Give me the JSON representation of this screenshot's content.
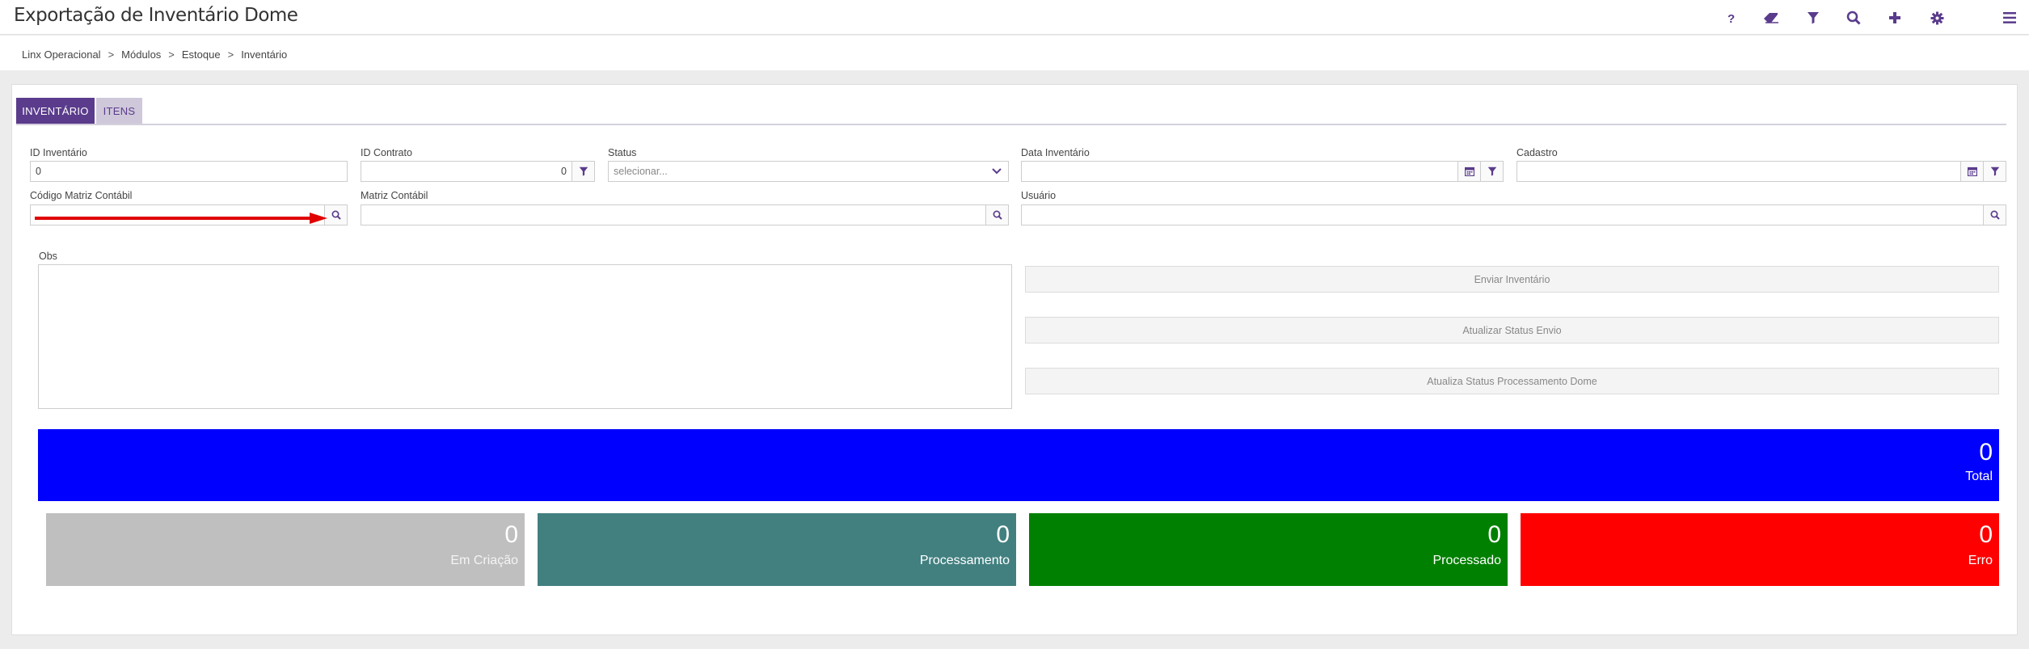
{
  "header": {
    "title": "Exportação de Inventário Dome",
    "icons": [
      "help-icon",
      "eraser-icon",
      "filter-icon",
      "search-icon",
      "plus-icon",
      "gear-icon",
      "menu-icon"
    ]
  },
  "breadcrumb": {
    "items": [
      "Linx Operacional",
      "Módulos",
      "Estoque",
      "Inventário"
    ],
    "separator": ">"
  },
  "tabs": [
    {
      "label": "INVENTÁRIO",
      "active": true
    },
    {
      "label": "ITENS",
      "active": false
    }
  ],
  "form": {
    "id_inventario": {
      "label": "ID Inventário",
      "value": "0"
    },
    "id_contrato": {
      "label": "ID Contrato",
      "value": "0"
    },
    "status": {
      "label": "Status",
      "placeholder": "selecionar..."
    },
    "data_inventario": {
      "label": "Data Inventário",
      "value": ""
    },
    "cadastro": {
      "label": "Cadastro",
      "value": ""
    },
    "codigo_matriz": {
      "label": "Código Matriz Contábil",
      "value": ""
    },
    "matriz_contabil": {
      "label": "Matriz Contábil",
      "value": ""
    },
    "usuario": {
      "label": "Usuário",
      "value": ""
    },
    "obs": {
      "label": "Obs",
      "value": ""
    }
  },
  "actions": {
    "enviar": "Enviar Inventário",
    "atualizar_envio": "Atualizar Status Envio",
    "atualiza_processamento": "Atualiza Status Processamento Dome"
  },
  "stats": {
    "total": {
      "value": "0",
      "label": "Total",
      "color": "#0000ff"
    },
    "em_criacao": {
      "value": "0",
      "label": "Em Criação",
      "color": "#bfbfbf"
    },
    "processamento": {
      "value": "0",
      "label": "Processamento",
      "color": "#428080"
    },
    "processado": {
      "value": "0",
      "label": "Processado",
      "color": "#008000"
    },
    "erro": {
      "value": "0",
      "label": "Erro",
      "color": "#ff0000"
    }
  },
  "colors": {
    "accent": "#5a3b8c",
    "annotation_arrow": "#e00000"
  }
}
